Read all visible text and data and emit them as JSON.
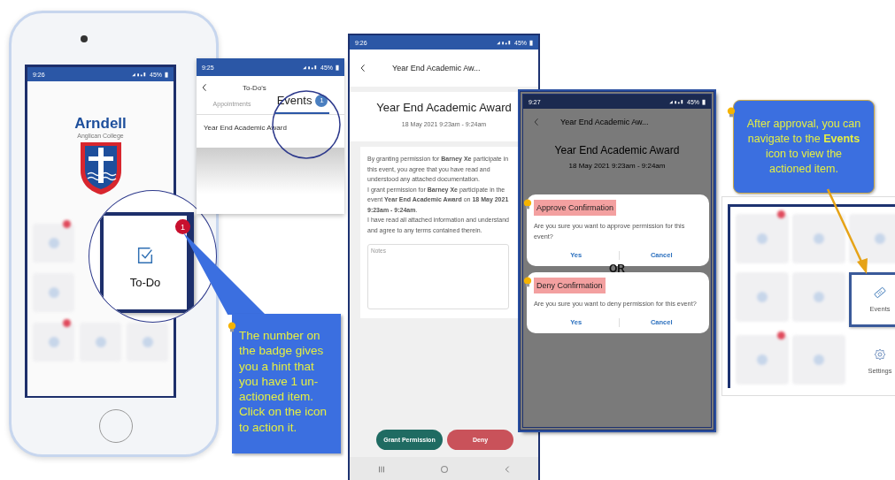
{
  "home_screen": {
    "status_time": "9:26",
    "battery": "45%",
    "logo_name": "Arndell",
    "logo_subtitle": "Anglican College",
    "magnified_tile": {
      "label": "To-Do",
      "badge": "1"
    }
  },
  "todo_screen": {
    "status_time": "9:25",
    "battery": "45%",
    "title": "To-Do's",
    "tabs": [
      {
        "label": "Appointments",
        "selected": false
      },
      {
        "label": "Events",
        "selected": true,
        "badge": "1"
      }
    ],
    "items": [
      {
        "title": "Year End Academic Award"
      }
    ]
  },
  "badge_hint": {
    "text": "The number on the badge gives you a hint that you have 1 un-actioned item. Click on the icon to action it."
  },
  "event_screen": {
    "status_time": "9:26",
    "battery": "45%",
    "header_title": "Year End Academic Aw...",
    "event_title": "Year End Academic Award",
    "event_date": "18 May 2021 9:23am - 9:24am",
    "paragraphs": [
      "By granting permission for **Barney Xe** participate in this event, you agree that you have read and understood any attached documentation.",
      "I grant permission for **Barney Xe** participate in the event **Year End Academic Award** on **18 May 2021 9:23am - 9:24am**.",
      "I have read all attached information and understand and agree to any terms contained therein."
    ],
    "notes_placeholder": "Notes",
    "buttons": [
      {
        "label": "Grant Permission",
        "kind": "grant"
      },
      {
        "label": "Deny",
        "kind": "deny"
      }
    ]
  },
  "confirm_screen": {
    "status_time": "9:27",
    "battery": "45%",
    "header_title": "Year End Academic Aw...",
    "event_title": "Year End Academic Award",
    "event_date": "18 May 2021 9:23am - 9:24am",
    "dialogs": [
      {
        "title": "Approve Confirmation",
        "message": "Are you sure you want to approve permission for this event?",
        "actions": [
          "Yes",
          "Cancel"
        ]
      },
      {
        "title": "Deny Confirmation",
        "message": "Are you sure you want to deny permission for this event?",
        "actions": [
          "Yes",
          "Cancel"
        ]
      }
    ],
    "separator": "OR"
  },
  "events_hint": {
    "text": "After approval, you can navigate to the **Events** icon to view the actioned item."
  },
  "menu_screen": {
    "tiles": [
      {
        "label": "Events",
        "kind": "events",
        "selected": true
      },
      {
        "label": "Settings",
        "kind": "settings",
        "selected": false
      }
    ]
  }
}
